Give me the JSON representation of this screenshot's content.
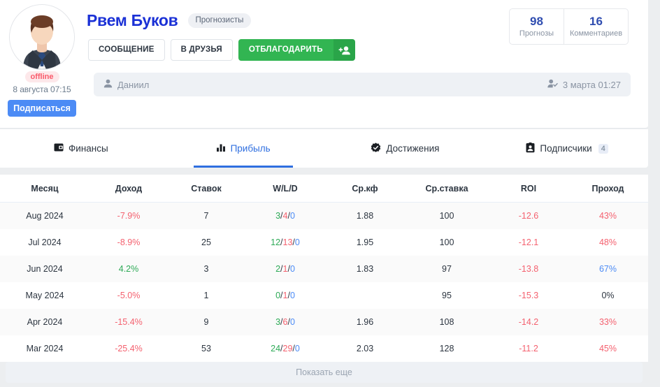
{
  "profile": {
    "name": "Рвем Буков",
    "role_badge": "Прогнозисты",
    "status": "offline",
    "last_seen": "8 августа 07:15",
    "subscribe_label": "Подписаться",
    "actions": {
      "message": "СООБЩЕНИЕ",
      "add_friend": "В ДРУЗЬЯ",
      "thanks": "ОТБЛАГОДАРИТЬ",
      "thanks_icon": "add-person-icon"
    },
    "info_bar": {
      "user_icon": "person-icon",
      "user_name": "Даниил",
      "date_icon": "person-check-icon",
      "date": "3 марта 01:27"
    },
    "stats": [
      {
        "value": "98",
        "label": "Прогнозы"
      },
      {
        "value": "16",
        "label": "Комментариев"
      }
    ]
  },
  "tabs": [
    {
      "label": "Финансы",
      "icon": "wallet-icon",
      "active": false,
      "count": ""
    },
    {
      "label": "Прибыль",
      "icon": "bar-chart-icon",
      "active": true,
      "count": ""
    },
    {
      "label": "Достижения",
      "icon": "verified-badge-icon",
      "active": false,
      "count": ""
    },
    {
      "label": "Подписчики",
      "icon": "contact-card-icon",
      "active": false,
      "count": "4"
    }
  ],
  "table": {
    "columns": [
      "Месяц",
      "Доход",
      "Ставок",
      "W/L/D",
      "Ср.кф",
      "Ср.ставка",
      "ROI",
      "Проход"
    ],
    "rows": [
      {
        "month": "Aug 2024",
        "income": "-7.9%",
        "income_sign": "neg",
        "bets": "7",
        "w": "3",
        "l": "4",
        "d": "0",
        "avg_odds": "1.88",
        "avg_stake": "100",
        "roi": "-12.6",
        "roi_sign": "neg",
        "pass": "43%",
        "pass_sign": "neg"
      },
      {
        "month": "Jul 2024",
        "income": "-8.9%",
        "income_sign": "neg",
        "bets": "25",
        "w": "12",
        "l": "13",
        "d": "0",
        "avg_odds": "1.95",
        "avg_stake": "100",
        "roi": "-12.1",
        "roi_sign": "neg",
        "pass": "48%",
        "pass_sign": "neg"
      },
      {
        "month": "Jun 2024",
        "income": "4.2%",
        "income_sign": "pos",
        "bets": "3",
        "w": "2",
        "l": "1",
        "d": "0",
        "avg_odds": "1.83",
        "avg_stake": "97",
        "roi": "-13.8",
        "roi_sign": "neg",
        "pass": "67%",
        "pass_sign": "blue"
      },
      {
        "month": "May 2024",
        "income": "-5.0%",
        "income_sign": "neg",
        "bets": "1",
        "w": "0",
        "l": "1",
        "d": "0",
        "avg_odds": "",
        "avg_stake": "95",
        "roi": "-15.3",
        "roi_sign": "neg",
        "pass": "0%",
        "pass_sign": "plain"
      },
      {
        "month": "Apr 2024",
        "income": "-15.4%",
        "income_sign": "neg",
        "bets": "9",
        "w": "3",
        "l": "6",
        "d": "0",
        "avg_odds": "1.96",
        "avg_stake": "108",
        "roi": "-14.2",
        "roi_sign": "neg",
        "pass": "33%",
        "pass_sign": "neg"
      },
      {
        "month": "Mar 2024",
        "income": "-25.4%",
        "income_sign": "neg",
        "bets": "53",
        "w": "24",
        "l": "29",
        "d": "0",
        "avg_odds": "2.03",
        "avg_stake": "128",
        "roi": "-11.2",
        "roi_sign": "neg",
        "pass": "45%",
        "pass_sign": "neg"
      }
    ]
  },
  "show_more_label": "Показать еще",
  "colors": {
    "name_blue": "#1b31d6",
    "accent_blue": "#2f6fe0",
    "green": "#32b552",
    "red": "#f4616f",
    "positive_green": "#2eaa57",
    "page_bg": "#eceef0"
  }
}
